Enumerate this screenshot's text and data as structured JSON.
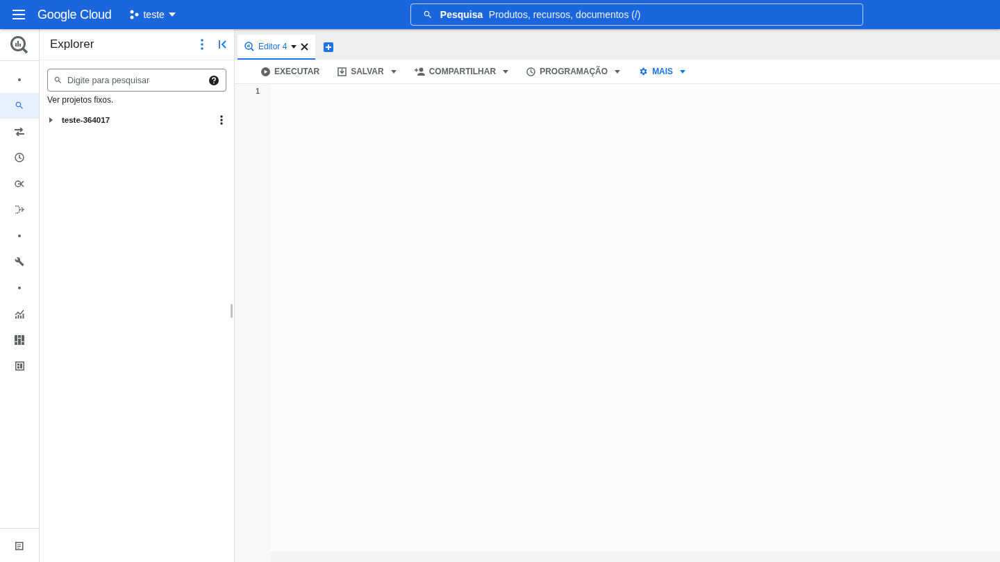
{
  "header": {
    "brand": "Google Cloud",
    "project": "teste",
    "search_label": "Pesquisa",
    "search_placeholder": "Produtos, recursos, documentos (/)"
  },
  "rail": [
    {
      "kind": "dot",
      "selected": false
    },
    {
      "kind": "search",
      "selected": true
    },
    {
      "kind": "transfer",
      "selected": false
    },
    {
      "kind": "clock",
      "selected": false
    },
    {
      "kind": "nodes",
      "selected": false
    },
    {
      "kind": "pipeline",
      "selected": false
    },
    {
      "kind": "dot",
      "selected": false
    },
    {
      "kind": "wrench",
      "selected": false
    },
    {
      "kind": "dot",
      "selected": false
    },
    {
      "kind": "chart",
      "selected": false
    },
    {
      "kind": "dashboard",
      "selected": false
    },
    {
      "kind": "table",
      "selected": false
    }
  ],
  "explorer": {
    "title": "Explorer",
    "search_placeholder": "Digite para pesquisar",
    "pinned_link": "Ver projetos fixos.",
    "tree": [
      {
        "label": "teste-364017",
        "expanded": false
      }
    ]
  },
  "tabs": [
    {
      "label": "Editor 4",
      "selected": true
    }
  ],
  "toolbar": [
    {
      "kind": "run",
      "label": "EXECUTAR",
      "dropdown": false,
      "active": false
    },
    {
      "kind": "save",
      "label": "SALVAR",
      "dropdown": true,
      "active": false
    },
    {
      "kind": "share",
      "label": "COMPARTILHAR",
      "dropdown": true,
      "active": false
    },
    {
      "kind": "schedule",
      "label": "PROGRAMAÇÃO",
      "dropdown": true,
      "active": false
    },
    {
      "kind": "settings",
      "label": "MAIS",
      "dropdown": true,
      "active": true
    }
  ],
  "editor": {
    "line_numbers": [
      "1"
    ]
  }
}
